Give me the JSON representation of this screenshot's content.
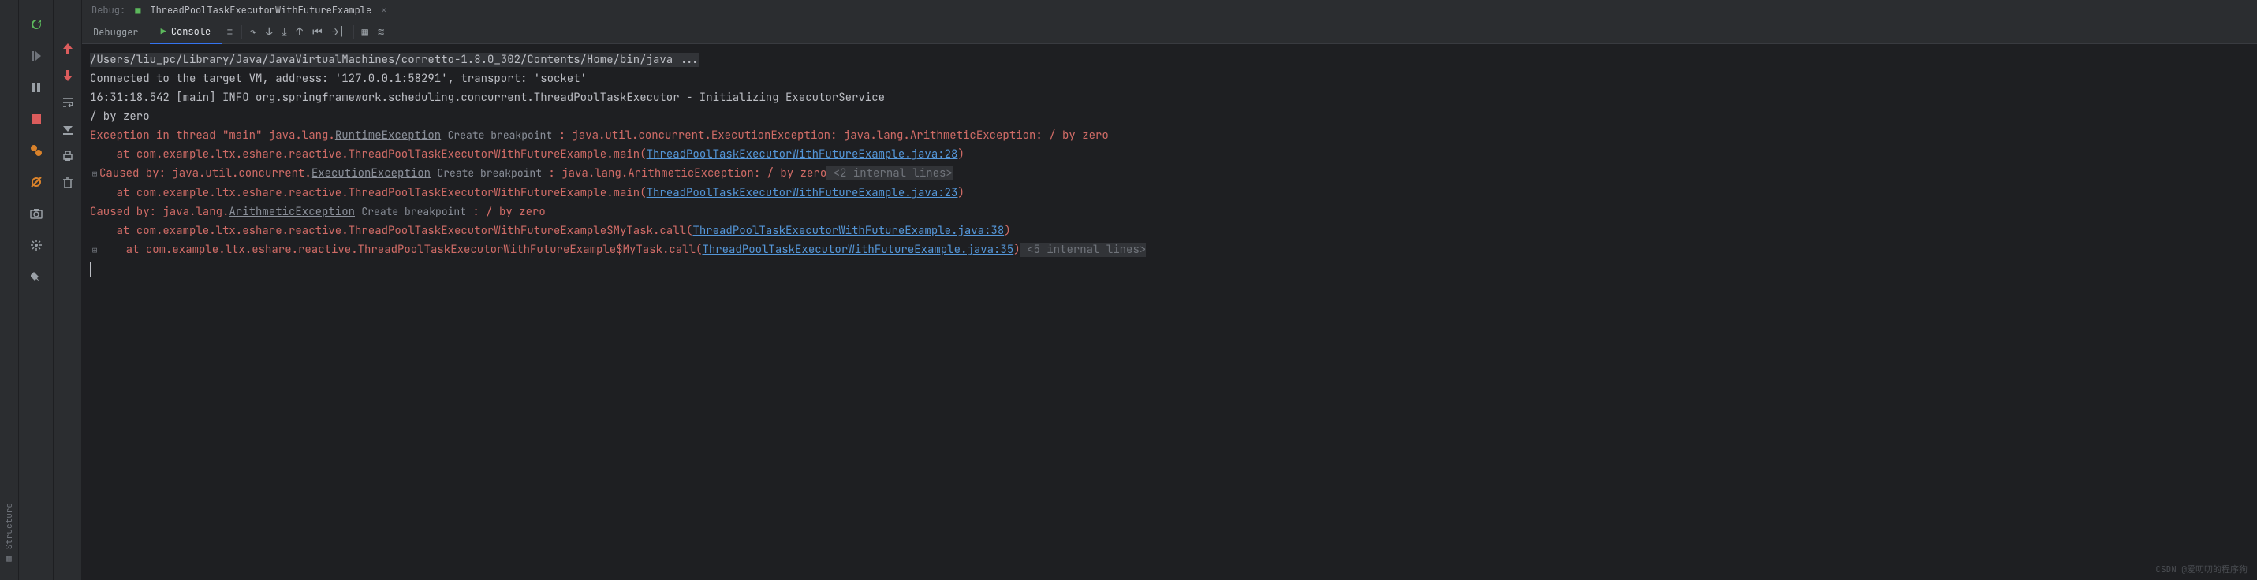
{
  "top": {
    "label": "Debug:",
    "run_config": "ThreadPoolTaskExecutorWithFutureExample"
  },
  "tabs": {
    "debugger": "Debugger",
    "console": "Console"
  },
  "sidebar_vert": "Structure",
  "console": {
    "cmd": "/Users/liu_pc/Library/Java/JavaVirtualMachines/corretto-1.8.0_302/Contents/Home/bin/java ...",
    "connected": "Connected to the target VM, address: '127.0.0.1:58291', transport: 'socket'",
    "log": "16:31:18.542 [main] INFO org.springframework.scheduling.concurrent.ThreadPoolTaskExecutor - Initializing ExecutorService",
    "byzero": "/ by zero",
    "ex1_pre": "Exception in thread \"main\" java.lang.",
    "ex1_link": "RuntimeException",
    "create_bp": "Create breakpoint",
    "ex1_post": " : java.util.concurrent.ExecutionException: java.lang.ArithmeticException: / by zero",
    "at": "    at ",
    "st1": "com.example.ltx.eshare.reactive.ThreadPoolTaskExecutorWithFutureExample.main(",
    "st1_link": "ThreadPoolTaskExecutorWithFutureExample.java:28",
    "cb1_pre": "Caused by: java.util.concurrent.",
    "cb1_link": "ExecutionException",
    "cb1_post": " : java.lang.ArithmeticException: / by zero",
    "internal1": " <2 internal lines>",
    "st2_link": "ThreadPoolTaskExecutorWithFutureExample.java:23",
    "cb2_pre": "Caused by: java.lang.",
    "cb2_link": "ArithmeticException",
    "cb2_post": " : / by zero",
    "st3": "com.example.ltx.eshare.reactive.ThreadPoolTaskExecutorWithFutureExample$MyTask.call(",
    "st3_link": "ThreadPoolTaskExecutorWithFutureExample.java:38",
    "st4_link": "ThreadPoolTaskExecutorWithFutureExample.java:35",
    "internal2": " <5 internal lines>"
  },
  "watermark": "CSDN @爱叨叨的程序狗"
}
